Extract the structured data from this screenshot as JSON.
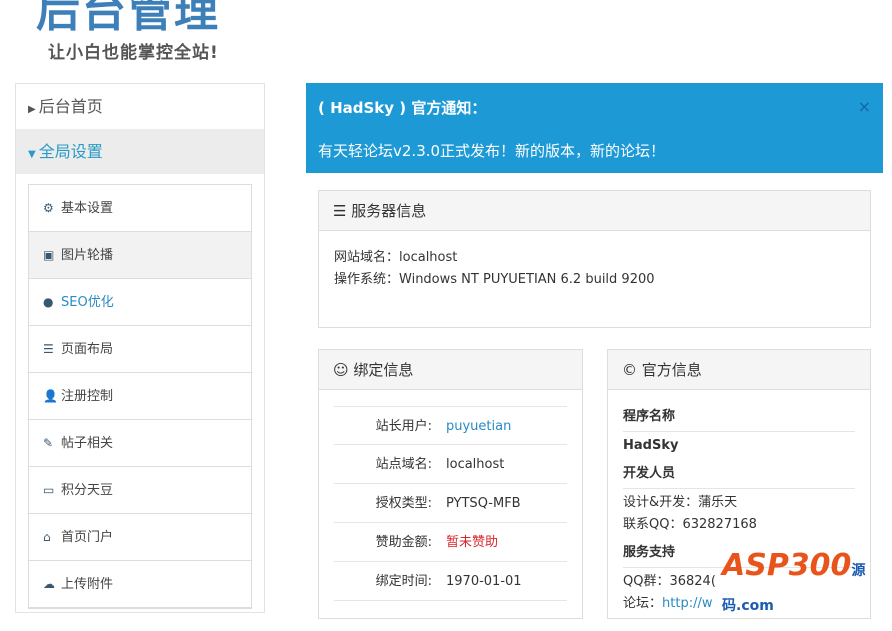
{
  "logo": {
    "title": "后台管理",
    "slogan": "让小白也能掌控全站!"
  },
  "sidebar": {
    "items": [
      {
        "label": "后台首页"
      },
      {
        "label": "全局设置"
      }
    ],
    "submenu": [
      {
        "label": "基本设置",
        "icon": "⚙"
      },
      {
        "label": "图片轮播",
        "icon": "▣"
      },
      {
        "label": "SEO优化",
        "icon": "●"
      },
      {
        "label": "页面布局",
        "icon": "☰"
      },
      {
        "label": "注册控制",
        "icon": "👤"
      },
      {
        "label": "帖子相关",
        "icon": "✎"
      },
      {
        "label": "积分天豆",
        "icon": "▭"
      },
      {
        "label": "首页门户",
        "icon": "⌂"
      },
      {
        "label": "上传附件",
        "icon": "☁"
      }
    ]
  },
  "notice": {
    "title": "( HadSky ) 官方通知：",
    "body": "有天轻论坛v2.3.0正式发布！新的版本，新的论坛！",
    "close": "×"
  },
  "server": {
    "title": "服务器信息",
    "domain_label": "网站域名：",
    "domain": "localhost",
    "os_label": "操作系统：",
    "os": "Windows NT PUYUETIAN 6.2 build 9200"
  },
  "bind": {
    "title": "绑定信息",
    "rows": [
      {
        "k": "站长用户:",
        "v": "puyuetian"
      },
      {
        "k": "站点域名:",
        "v": "localhost"
      },
      {
        "k": "授权类型:",
        "v": "PYTSQ-MFB"
      },
      {
        "k": "赞助金额:",
        "v": "暂未赞助"
      },
      {
        "k": "绑定时间:",
        "v": "1970-01-01"
      }
    ]
  },
  "official": {
    "title": "官方信息",
    "name_h": "程序名称",
    "name": "HadSky",
    "dev_h": "开发人员",
    "dev1": "设计&开发：蒲乐天",
    "dev2": "联系QQ：632827168",
    "support_h": "服务支持",
    "qq": "QQ群：36824(",
    "forum_label": "论坛：",
    "forum": "http://w"
  },
  "watermark": {
    "text": "ASP300",
    "sub": "源码.com"
  }
}
